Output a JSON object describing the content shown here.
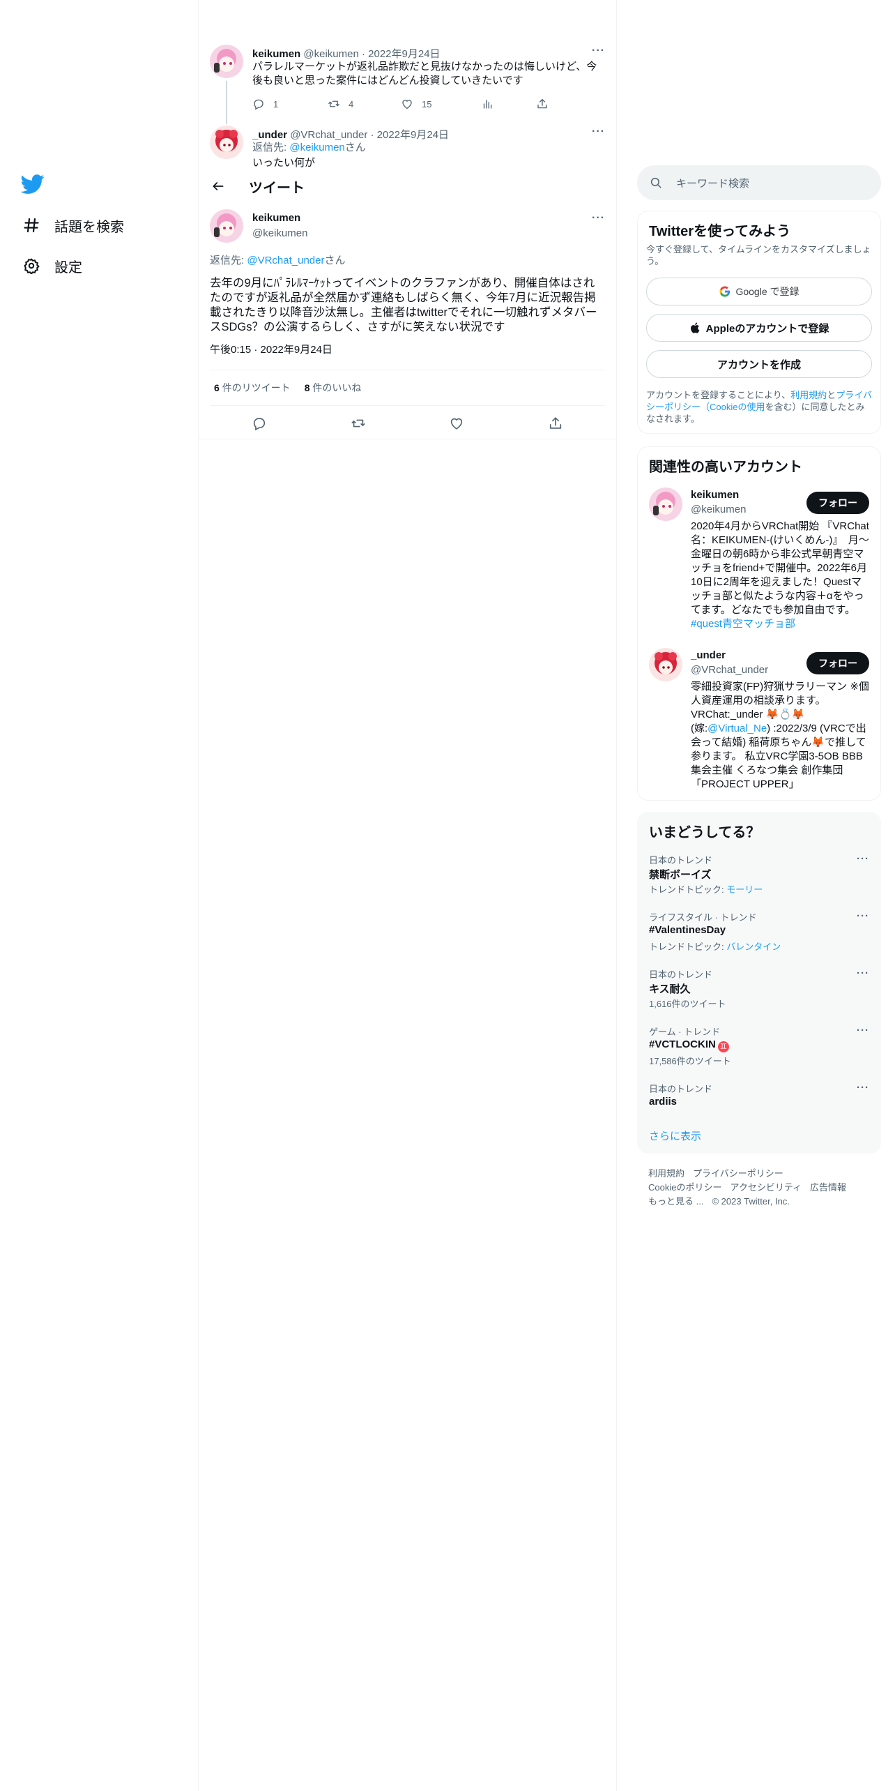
{
  "nav": {
    "explore_label": "話題を検索",
    "settings_label": "設定"
  },
  "thread": {
    "tweet1": {
      "name": "keikumen",
      "handle": "@keikumen",
      "date": "· 2022年9月24日",
      "text": "パラレルマーケットが返礼品詐欺だと見抜けなかったのは悔しいけど、今後も良いと思った案件にはどんどん投資していきたいです",
      "reply_count": "1",
      "retweet_count": "4",
      "like_count": "15"
    },
    "tweet2": {
      "name": "_under",
      "handle": "@VRchat_under",
      "date": "· 2022年9月24日",
      "reply_prefix": "返信先: ",
      "reply_to": "@keikumen",
      "reply_suffix": "さん",
      "text": "いったい何が"
    }
  },
  "header": {
    "title": "ツイート"
  },
  "main_tweet": {
    "name": "keikumen",
    "handle": "@keikumen",
    "reply_prefix": "返信先: ",
    "reply_to": "@VRchat_under",
    "reply_suffix": "さん",
    "text": "去年の9月にﾊﾟﾗﾚﾙﾏｰｹｯﾄってイベントのクラファンがあり、開催自体はされたのですが返礼品が全然届かず連絡もしばらく無く、今年7月に近況報告掲載されたきり以降音沙汰無し。主催者はtwitterでそれに一切触れずメタバースSDGs？の公演するらしく、さすがに笑えない状況です",
    "timestamp": "午後0:15 · 2022年9月24日",
    "retweets_num": "6",
    "retweets_label": "件のリツイート",
    "likes_num": "8",
    "likes_label": "件のいいね"
  },
  "search": {
    "placeholder": "キーワード検索"
  },
  "signup": {
    "title": "Twitterを使ってみよう",
    "subtitle": "今すぐ登録して、タイムラインをカスタマイズしましょう。",
    "google_label": "Google で登録",
    "apple_label": "Appleのアカウントで登録",
    "create_label": "アカウントを作成",
    "legal_1": "アカウントを登録することにより、",
    "legal_terms": "利用規約",
    "legal_2": "と",
    "legal_privacy": "プライバシーポリシー（Cookieの使用",
    "legal_3": "を含む）に同意したとみなされます。"
  },
  "relevant": {
    "title": "関連性の高いアカウント",
    "follow_label": "フォロー",
    "accounts": [
      {
        "name": "keikumen",
        "handle": "@keikumen",
        "bio": "2020年4月からVRChat開始 『VRChat名：KEIKUMEN-(けいくめん-)』　月〜金曜日の朝6時から非公式早朝青空マッチョをfriend+で開催中。2022年6月10日に2周年を迎えました！Questマッチョ部と似たような内容＋αをやってます。どなたでも参加自由です。",
        "bio_link": "#quest青空マッチョ部"
      },
      {
        "name": "_under",
        "handle": "@VRchat_under",
        "bio_1": "零細投資家(FP)狩猟サラリーマン ※個人資産運用の相談承ります。 VRChat:_under 🦊💍🦊(嫁:",
        "bio_link": "@Virtual_Ne",
        "bio_2": ") :2022/3/9 (VRCで出会って結婚) 稲荷原ちゃん🦊で推して参ります。 私立VRC学園3-5OB BBB集会主催 くろなつ集会 創作集団「PROJECT UPPER」"
      }
    ]
  },
  "trends": {
    "title": "いまどうしてる？",
    "items": [
      {
        "context": "日本のトレンド",
        "name": "禁断ボーイズ",
        "sub_prefix": "トレンドトピック: ",
        "sub_link": "モーリー"
      },
      {
        "context": "ライフスタイル · トレンド",
        "name": "#ValentinesDay",
        "sub_prefix": "トレンドトピック: ",
        "sub_link": "バレンタイン"
      },
      {
        "context": "日本のトレンド",
        "name": "キス耐久",
        "sub_count": "1,616件のツイート"
      },
      {
        "context": "ゲーム · トレンド",
        "name": "#VCTLOCKIN",
        "emoji": "♊",
        "sub_count": "17,586件のツイート"
      },
      {
        "context": "日本のトレンド",
        "name": "ardiis"
      }
    ],
    "show_more": "さらに表示"
  },
  "footer": {
    "terms": "利用規約",
    "privacy": "プライバシーポリシー",
    "cookie": "Cookieのポリシー",
    "accessibility": "アクセシビリティ",
    "ads": "広告情報",
    "more": "もっと見る ...",
    "copyright": "© 2023 Twitter, Inc."
  },
  "colors": {
    "accent": "#1d9bf0",
    "text": "#0f1419",
    "secondary": "#536471",
    "border": "#eff3f4"
  }
}
